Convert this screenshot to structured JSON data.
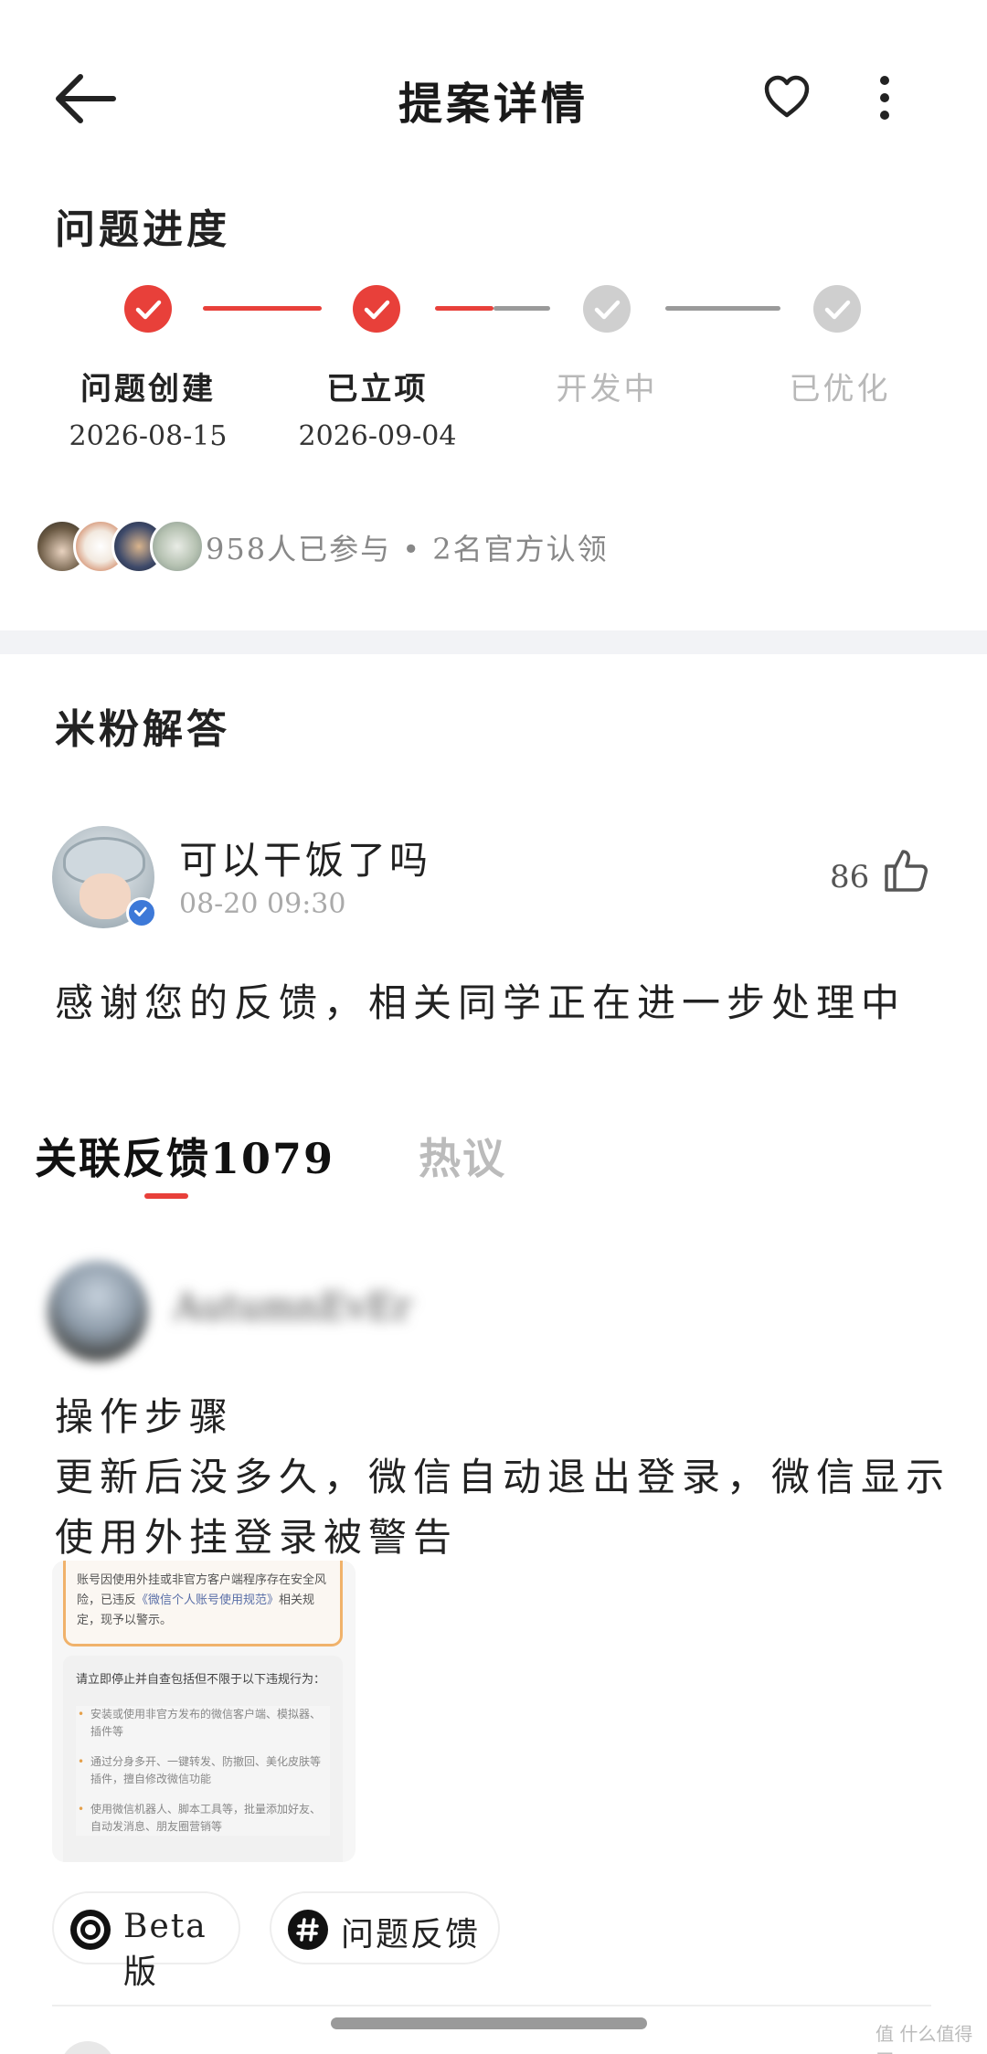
{
  "header": {
    "title": "提案详情"
  },
  "progress": {
    "title": "问题进度",
    "steps": [
      {
        "label": "问题创建",
        "date": "2026-08-15"
      },
      {
        "label": "已立项",
        "date": "2026-09-04"
      },
      {
        "label": "开发中",
        "date": ""
      },
      {
        "label": "已优化",
        "date": ""
      }
    ],
    "completed_steps": 2,
    "participants_text": "958人已参与 • 2名官方认领"
  },
  "answer": {
    "section_title": "米粉解答",
    "name": "可以干饭了吗",
    "time": "08-20  09:30",
    "likes": "86",
    "text": "感谢您的反馈，相关同学正在进一步处理中"
  },
  "tabs": {
    "related": "关联反馈1079",
    "hot": "热议"
  },
  "post": {
    "name": "AutumnEvEr",
    "line1": "操作步骤",
    "line2": "更新后没多久，微信自动退出登录，微信显示",
    "line3": "使用外挂登录被警告",
    "image": {
      "warn_1": "账号因使用外挂或非官方客户端程序存在安全风险，已违反",
      "warn_link": "《微信个人账号使用规范》",
      "warn_2": "相关规定，现予以警示。",
      "body_title": "请立即停止并自查包括但不限于以下违规行为：",
      "item_1": "安装或使用非官方发布的微信客户端、模拟器、插件等",
      "item_2": "通过分身多开、一键转发、防撤回、美化皮肤等插件，擅自修改微信功能",
      "item_3": "使用微信机器人、脚本工具等，批量添加好友、自动发消息、朋友圈营销等"
    },
    "chips": [
      "Beta版",
      "问题反馈"
    ]
  },
  "watermark": "值 什么值得买",
  "colors": {
    "accent": "#e8403a",
    "inactive": "#cfcfcf",
    "verify": "#3d79d8"
  }
}
